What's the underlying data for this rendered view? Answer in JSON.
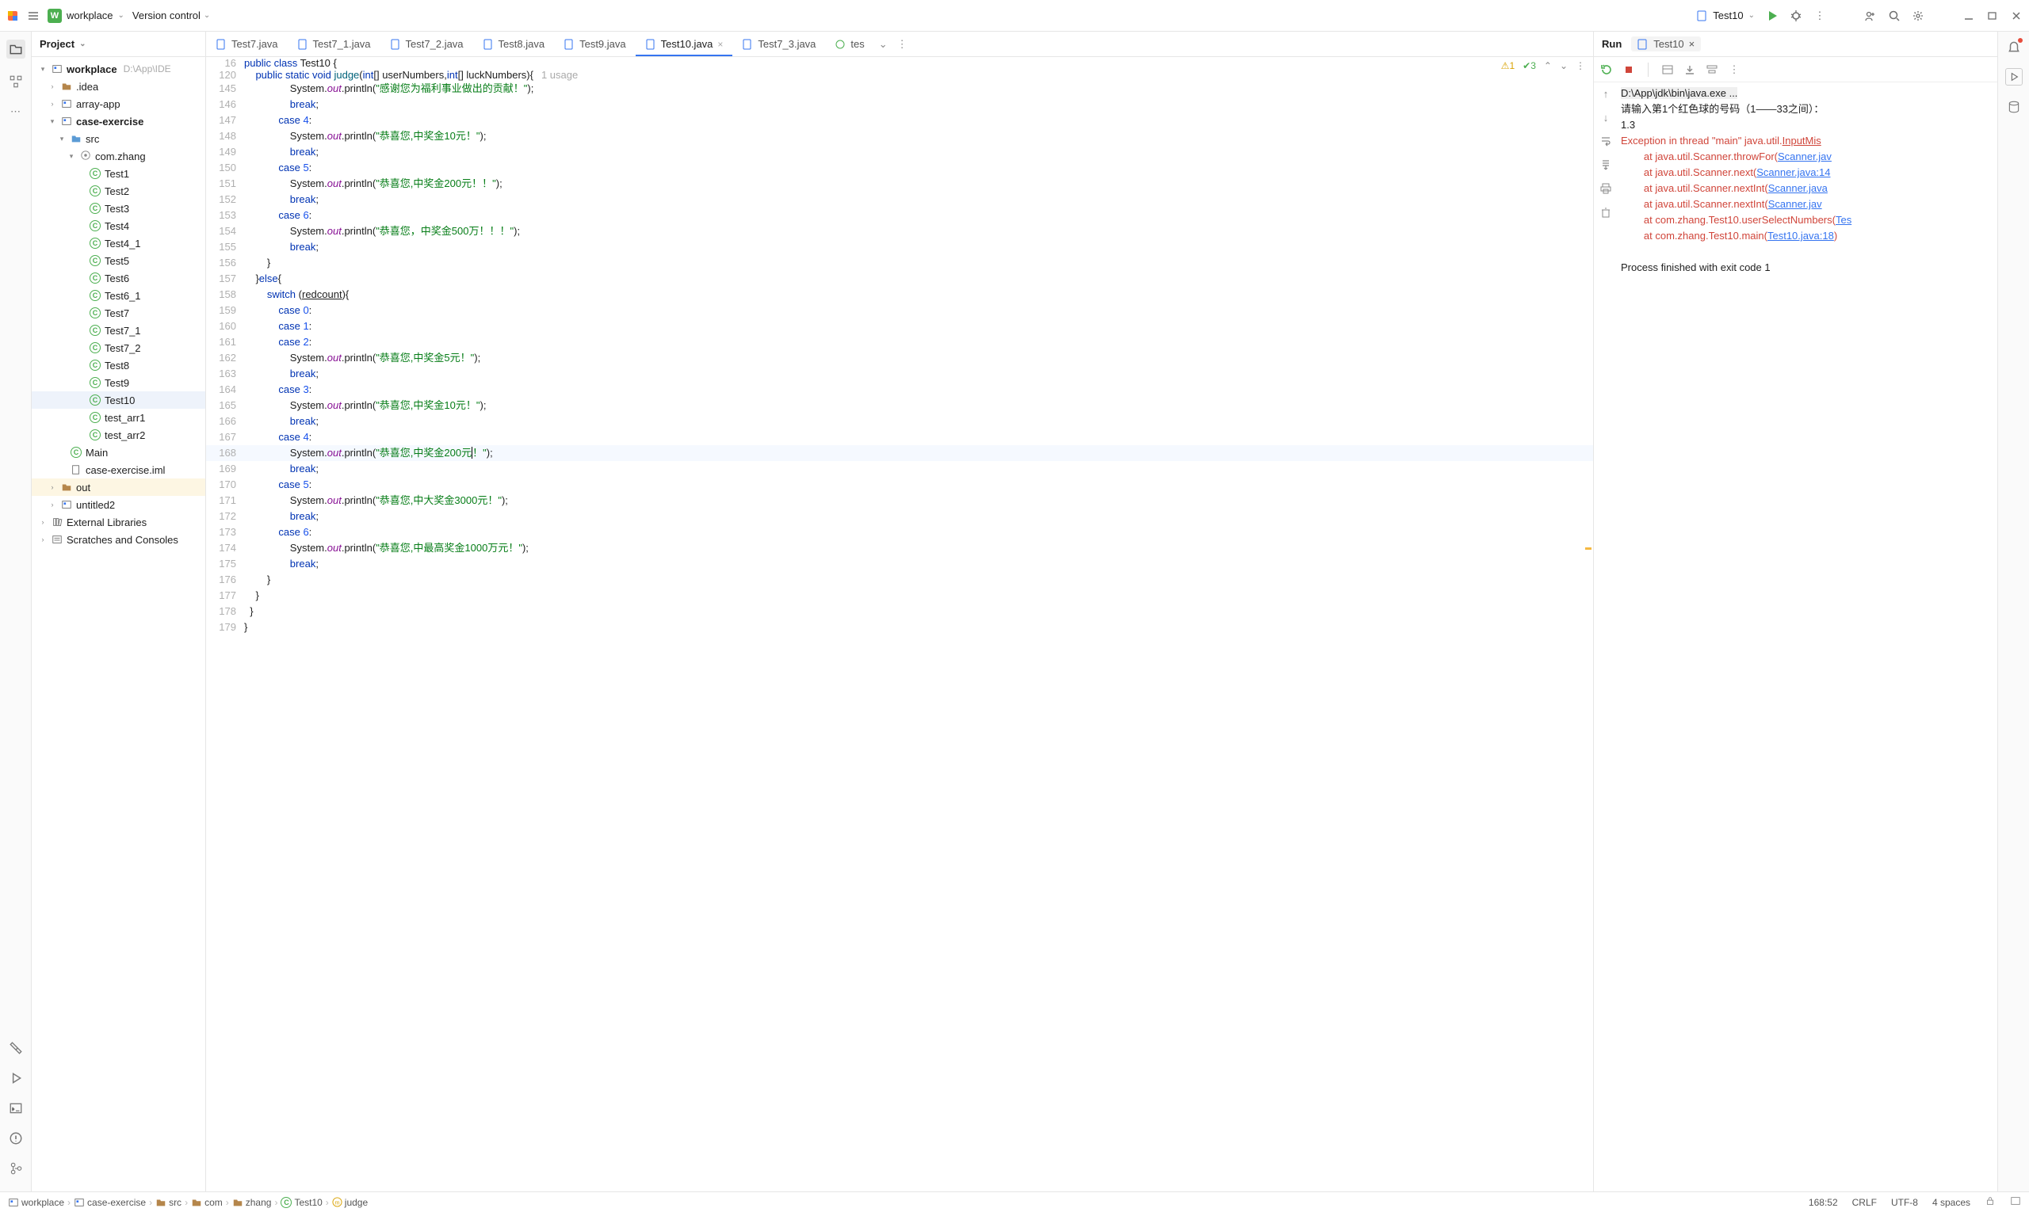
{
  "navbar": {
    "project_initial": "W",
    "project_name": "workplace",
    "vcs_label": "Version control",
    "run_config": "Test10"
  },
  "sidebar_title": "Project",
  "tree": {
    "root": {
      "name": "workplace",
      "path": "D:\\App\\IDE"
    },
    "idea": ".idea",
    "array_app": "array-app",
    "case_exercise": "case-exercise",
    "src": "src",
    "pkg": "com.zhang",
    "classes": [
      "Test1",
      "Test2",
      "Test3",
      "Test4",
      "Test4_1",
      "Test5",
      "Test6",
      "Test6_1",
      "Test7",
      "Test7_1",
      "Test7_2",
      "Test8",
      "Test9",
      "Test10",
      "test_arr1",
      "test_arr2"
    ],
    "main": "Main",
    "iml": "case-exercise.iml",
    "out": "out",
    "untitled2": "untitled2",
    "ext_lib": "External Libraries",
    "scratches": "Scratches and Consoles"
  },
  "tabs": [
    "Test7.java",
    "Test7_1.java",
    "Test7_2.java",
    "Test8.java",
    "Test9.java",
    "Test10.java",
    "Test7_3.java",
    "tes"
  ],
  "active_tab": "Test10.java",
  "sticky": {
    "l1_num": "16",
    "l1_html": "<span class='kw'>public class</span> Test10 {",
    "l2_num": "120",
    "l2_html": "    <span class='kw'>public static void</span> <span class='mth'>judge</span>(<span class='kw'>int</span>[] userNumbers,<span class='kw'>int</span>[] luckNumbers){",
    "usage": "1 usage",
    "warn_count": "1",
    "ok_count": "3"
  },
  "code": [
    {
      "n": "145",
      "h": "                System.<span class='fld'>out</span>.println(<span class='str'>\"感谢您为福利事业做出的贡献！\"</span>);"
    },
    {
      "n": "146",
      "h": "                <span class='kw'>break</span>;"
    },
    {
      "n": "147",
      "h": "            <span class='kw'>case</span> <span class='num'>4</span>:"
    },
    {
      "n": "148",
      "h": "                System.<span class='fld'>out</span>.println(<span class='str'>\"恭喜您,中奖金10元！\"</span>);"
    },
    {
      "n": "149",
      "h": "                <span class='kw'>break</span>;"
    },
    {
      "n": "150",
      "h": "            <span class='kw'>case</span> <span class='num'>5</span>:"
    },
    {
      "n": "151",
      "h": "                System.<span class='fld'>out</span>.println(<span class='str'>\"恭喜您,中奖金200元！！\"</span>);"
    },
    {
      "n": "152",
      "h": "                <span class='kw'>break</span>;"
    },
    {
      "n": "153",
      "h": "            <span class='kw'>case</span> <span class='num'>6</span>:"
    },
    {
      "n": "154",
      "h": "                System.<span class='fld'>out</span>.println(<span class='str'>\"恭喜您，中奖金500万！！！\"</span>);"
    },
    {
      "n": "155",
      "h": "                <span class='kw'>break</span>;"
    },
    {
      "n": "156",
      "h": "        }"
    },
    {
      "n": "157",
      "h": "    }<span class='kw'>else</span>{"
    },
    {
      "n": "158",
      "h": "        <span class='kw'>switch</span> (<u>redcount</u>){"
    },
    {
      "n": "159",
      "h": "            <span class='kw'>case</span> <span class='num'>0</span>:"
    },
    {
      "n": "160",
      "h": "            <span class='kw'>case</span> <span class='num'>1</span>:"
    },
    {
      "n": "161",
      "h": "            <span class='kw'>case</span> <span class='num'>2</span>:"
    },
    {
      "n": "162",
      "h": "                System.<span class='fld'>out</span>.println(<span class='str'>\"恭喜您,中奖金5元！\"</span>);"
    },
    {
      "n": "163",
      "h": "                <span class='kw'>break</span>;"
    },
    {
      "n": "164",
      "h": "            <span class='kw'>case</span> <span class='num'>3</span>:"
    },
    {
      "n": "165",
      "h": "                System.<span class='fld'>out</span>.println(<span class='str'>\"恭喜您,中奖金10元！\"</span>);"
    },
    {
      "n": "166",
      "h": "                <span class='kw'>break</span>;"
    },
    {
      "n": "167",
      "h": "            <span class='kw'>case</span> <span class='num'>4</span>:"
    },
    {
      "n": "168",
      "h": "                System.<span class='fld'>out</span>.println(<span class='str'>\"恭喜您,中奖金200元<span class='cursor'></span>！\"</span>);",
      "hl": true
    },
    {
      "n": "169",
      "h": "                <span class='kw'>break</span>;"
    },
    {
      "n": "170",
      "h": "            <span class='kw'>case</span> <span class='num'>5</span>:"
    },
    {
      "n": "171",
      "h": "                System.<span class='fld'>out</span>.println(<span class='str'>\"恭喜您,中大奖金3000元！\"</span>);"
    },
    {
      "n": "172",
      "h": "                <span class='kw'>break</span>;"
    },
    {
      "n": "173",
      "h": "            <span class='kw'>case</span> <span class='num'>6</span>:"
    },
    {
      "n": "174",
      "h": "                System.<span class='fld'>out</span>.println(<span class='str'>\"恭喜您,中最高奖金1000万元！\"</span>);"
    },
    {
      "n": "175",
      "h": "                <span class='kw'>break</span>;"
    },
    {
      "n": "176",
      "h": "        }"
    },
    {
      "n": "177",
      "h": "    }"
    },
    {
      "n": "178",
      "h": "  }"
    },
    {
      "n": "179",
      "h": "}"
    }
  ],
  "run": {
    "title": "Run",
    "tab": "Test10",
    "lines": [
      {
        "t": "cmd",
        "s": "D:\\App\\jdk\\bin\\java.exe ..."
      },
      {
        "t": "plain",
        "s": "请输入第1个红色球的号码（1——33之间）："
      },
      {
        "t": "plain",
        "s": "1.3"
      },
      {
        "t": "err-start",
        "pre": "Exception in thread \"main\" java.util.",
        "link": "InputMis"
      },
      {
        "t": "at",
        "pre": "\tat java.util.Scanner.throwFor(",
        "link": "Scanner.jav"
      },
      {
        "t": "at",
        "pre": "\tat java.util.Scanner.next(",
        "link": "Scanner.java:14"
      },
      {
        "t": "at",
        "pre": "\tat java.util.Scanner.nextInt(",
        "link": "Scanner.java"
      },
      {
        "t": "at",
        "pre": "\tat java.util.Scanner.nextInt(",
        "link": "Scanner.jav"
      },
      {
        "t": "at",
        "pre": "\tat com.zhang.Test10.userSelectNumbers(",
        "link": "Tes"
      },
      {
        "t": "at-close",
        "pre": "\tat com.zhang.Test10.main(",
        "link": "Test10.java:18",
        "post": ")"
      },
      {
        "t": "blank",
        "s": ""
      },
      {
        "t": "plain",
        "s": "Process finished with exit code 1"
      }
    ]
  },
  "breadcrumb": [
    "workplace",
    "case-exercise",
    "src",
    "com",
    "zhang",
    "Test10",
    "judge"
  ],
  "breadcrumb_icons": [
    "mod",
    "mod",
    "folder",
    "folder",
    "folder",
    "class",
    "method"
  ],
  "status": {
    "pos": "168:52",
    "sep": "CRLF",
    "enc": "UTF-8",
    "indent": "4 spaces"
  }
}
